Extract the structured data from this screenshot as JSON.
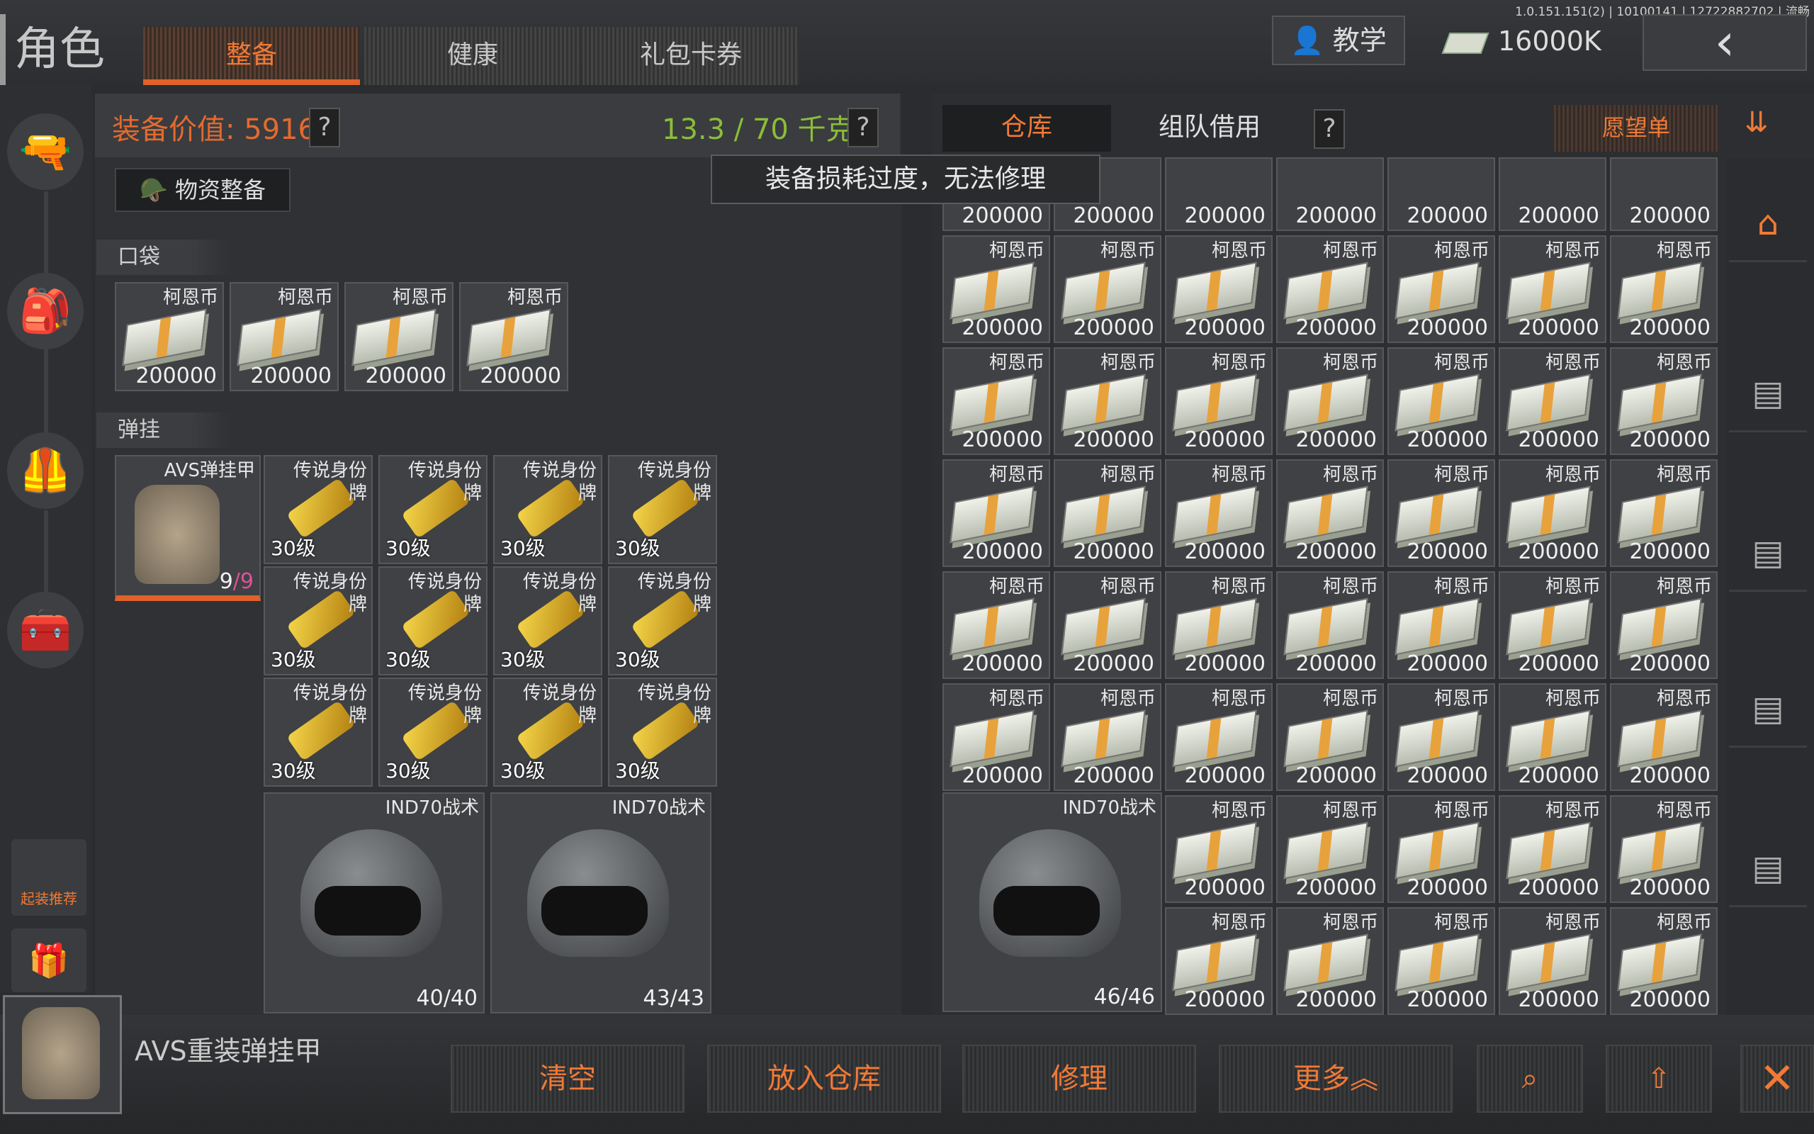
{
  "version_info": "1.0.151.151(2) | 10100141 | 12722882702 | 流畅",
  "title": "角色",
  "tabs": [
    {
      "label": "整备",
      "active": true
    },
    {
      "label": "健康",
      "active": false
    },
    {
      "label": "礼包卡券",
      "active": false
    }
  ],
  "tutorial_label": "教学",
  "currency": {
    "value": "16000K",
    "icon": "cash-stack-icon"
  },
  "left_nav": [
    "weapon-icon",
    "backpack-icon",
    "armor-icon",
    "toolbox-icon"
  ],
  "recommend_label": "起装推荐",
  "loadout": {
    "equip_value": "装备价值: 5916",
    "weight": "13.3 / 70 千克",
    "help": "?",
    "supply_button": "物资整备",
    "pocket_label": "口袋",
    "rig_label": "弹挂",
    "pocket_items": [
      {
        "name": "柯恩币",
        "qty": "200000"
      },
      {
        "name": "柯恩币",
        "qty": "200000"
      },
      {
        "name": "柯恩币",
        "qty": "200000"
      },
      {
        "name": "柯恩币",
        "qty": "200000"
      }
    ],
    "rig": {
      "name": "AVS弹挂甲",
      "capacity": "9",
      "used": "9",
      "slash": "/"
    },
    "tag_items": [
      {
        "name": "传说身份牌",
        "level": "30级"
      },
      {
        "name": "传说身份牌",
        "level": "30级"
      },
      {
        "name": "传说身份牌",
        "level": "30级"
      },
      {
        "name": "传说身份牌",
        "level": "30级"
      },
      {
        "name": "传说身份牌",
        "level": "30级"
      },
      {
        "name": "传说身份牌",
        "level": "30级"
      },
      {
        "name": "传说身份牌",
        "level": "30级"
      },
      {
        "name": "传说身份牌",
        "level": "30级"
      },
      {
        "name": "传说身份牌",
        "level": "30级"
      },
      {
        "name": "传说身份牌",
        "level": "30级"
      },
      {
        "name": "传说身份牌",
        "level": "30级"
      },
      {
        "name": "传说身份牌",
        "level": "30级"
      }
    ],
    "helmets": [
      {
        "name": "IND70战术",
        "durability": "40/40"
      },
      {
        "name": "IND70战术",
        "durability": "43/43"
      }
    ]
  },
  "storage": {
    "tabs": [
      {
        "label": "仓库",
        "active": true
      },
      {
        "label": "组队借用",
        "active": false
      }
    ],
    "help": "?",
    "wishlist_label": "愿望单",
    "cash_name": "柯恩币",
    "cash_qty": "200000",
    "helmet": {
      "name": "IND70战术",
      "durability": "46/46"
    }
  },
  "tooltip": "装备损耗过度，无法修理",
  "selected_item": {
    "name": "AVS重装弹挂甲"
  },
  "actions": [
    {
      "label": "清空",
      "name": "clear-button"
    },
    {
      "label": "放入仓库",
      "name": "store-button"
    },
    {
      "label": "修理",
      "name": "repair-button"
    },
    {
      "label": "更多︽",
      "name": "more-button"
    }
  ],
  "colors": {
    "accent": "#e36a2f",
    "weight": "#8bbd3a",
    "panel": "#2f3134"
  }
}
